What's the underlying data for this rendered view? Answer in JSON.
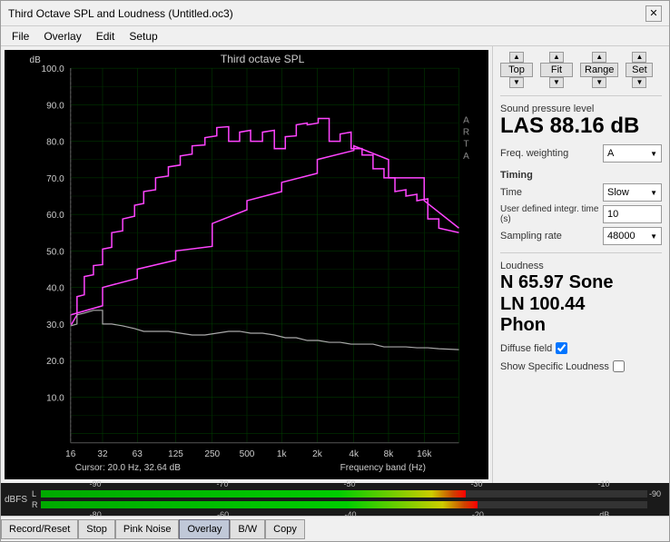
{
  "window": {
    "title": "Third Octave SPL and Loudness (Untitled.oc3)",
    "close_label": "✕"
  },
  "menu": {
    "items": [
      "File",
      "Overlay",
      "Edit",
      "Setup"
    ]
  },
  "chart": {
    "title": "Third octave SPL",
    "y_label": "dB",
    "y_max": "100.0",
    "y_ticks": [
      "100.0",
      "90.0",
      "80.0",
      "70.0",
      "60.0",
      "50.0",
      "40.0",
      "30.0",
      "20.0",
      "10.0"
    ],
    "x_ticks": [
      "16",
      "32",
      "63",
      "125",
      "250",
      "500",
      "1k",
      "2k",
      "4k",
      "8k",
      "16k"
    ],
    "x_label": "Frequency band (Hz)",
    "cursor_text": "Cursor:  20.0 Hz, 32.64 dB",
    "arta_label": "A\nR\nT\nA"
  },
  "top_controls": {
    "top_label": "Top",
    "fit_label": "Fit",
    "range_label": "Range",
    "set_label": "Set"
  },
  "spl": {
    "section_label": "Sound pressure level",
    "value": "LAS 88.16 dB"
  },
  "freq_weighting": {
    "label": "Freq. weighting",
    "value": "A"
  },
  "timing": {
    "section_label": "Timing",
    "time_label": "Time",
    "time_value": "Slow",
    "user_defined_label": "User defined integr. time (s)",
    "user_defined_value": "10",
    "sampling_label": "Sampling rate",
    "sampling_value": "48000"
  },
  "loudness": {
    "section_label": "Loudness",
    "n_value": "N 65.97 Sone",
    "ln_value": "LN 100.44",
    "phon_label": "Phon",
    "diffuse_field_label": "Diffuse field",
    "show_specific_label": "Show Specific Loudness"
  },
  "meter": {
    "dbfs_label": "dBFS",
    "l_label": "L",
    "r_label": "R",
    "scale": [
      "-90",
      "-70",
      "-50",
      "-30",
      "-10"
    ],
    "scale2": [
      "-80",
      "-60",
      "-40",
      "-20",
      "dB"
    ],
    "l_db": "-90",
    "r_db": ""
  },
  "bottom_buttons": {
    "record_reset": "Record/Reset",
    "stop": "Stop",
    "pink_noise": "Pink Noise",
    "overlay": "Overlay",
    "bw": "B/W",
    "copy": "Copy"
  }
}
